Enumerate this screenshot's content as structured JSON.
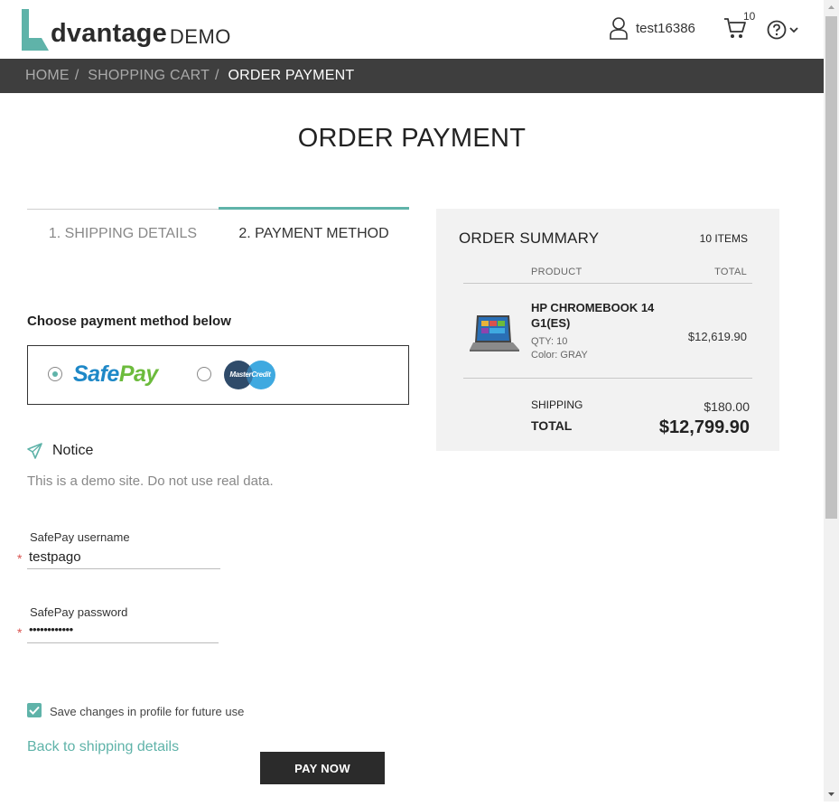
{
  "header": {
    "logo_letter": "A",
    "logo_text": "dvantage",
    "logo_demo": "DEMO",
    "username": "test16386",
    "cart_count": "10"
  },
  "breadcrumb": {
    "home": "HOME",
    "cart": "SHOPPING CART",
    "current": "ORDER PAYMENT",
    "separator": "/"
  },
  "page_title": "ORDER PAYMENT",
  "steps": {
    "shipping": "1. SHIPPING DETAILS",
    "payment": "2. PAYMENT METHOD"
  },
  "payment": {
    "choose_label": "Choose payment method below",
    "safepay_safe": "Safe",
    "safepay_pay": "Pay",
    "mastercredit": "MasterCredit",
    "selected": "SafePay"
  },
  "notice": {
    "title": "Notice",
    "text": "This is a demo site. Do not use real data."
  },
  "form": {
    "username_label": "SafePay username",
    "username_value": "testpago",
    "password_label": "SafePay password",
    "password_value": "••••••••••••",
    "required_mark": "*",
    "save_label": "Save changes in profile for future use",
    "save_checked": true,
    "back_link": "Back to shipping details",
    "pay_button": "PAY NOW"
  },
  "summary": {
    "title": "ORDER SUMMARY",
    "items": "10 ITEMS",
    "col_product": "PRODUCT",
    "col_total": "TOTAL",
    "product_name": "HP CHROMEBOOK 14 G1(ES)",
    "product_qty": "QTY: 10",
    "product_color": "Color: GRAY",
    "product_total": "$12,619.90",
    "shipping_label": "SHIPPING",
    "shipping_value": "$180.00",
    "total_label": "TOTAL",
    "total_value": "$12,799.90"
  },
  "colors": {
    "accent": "#5fb3a9",
    "breadcrumb_bg": "#3e3e3e",
    "summary_bg": "#f2f2f2",
    "button_bg": "#2b2b2b"
  },
  "icons": [
    "logo-icon",
    "user-icon",
    "cart-icon",
    "help-icon",
    "chevron-down-icon",
    "notice-icon",
    "checkmark-icon",
    "laptop-thumbnail"
  ]
}
